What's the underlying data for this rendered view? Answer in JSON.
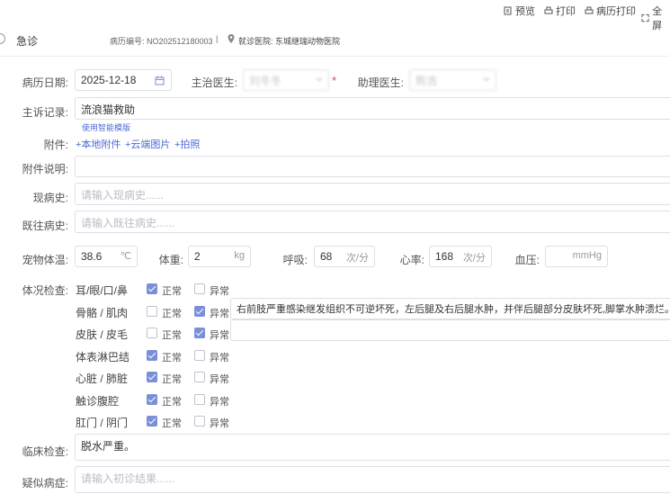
{
  "toolbar": {
    "preview": "预览",
    "print": "打印",
    "record_print": "病历打印",
    "fullscreen": "全屏"
  },
  "header": {
    "status": "急诊",
    "record_no": "病历编号: NO202512180003",
    "sep": "|",
    "hospital": "就诊医院: 东城继瑞动物医院"
  },
  "form": {
    "date_label": "病历日期:",
    "date_value": "2025-12-18",
    "doctor_label": "主治医生:",
    "doctor_value": "刘冬冬",
    "required_mark": "*",
    "assistant_label": "助理医生:",
    "assistant_value": "熊浩",
    "complaint_label": "主诉记录:",
    "complaint_value": "流浪猫救助",
    "template_link": "使用智能模版",
    "attach_label": "附件:",
    "attach_local": "+本地附件",
    "attach_cloud": "+云端图片",
    "attach_photo": "+拍照",
    "attach_desc_label": "附件说明:",
    "present_label": "现病史:",
    "present_placeholder": "请输入现病史......",
    "past_label": "既往病史:",
    "past_placeholder": "请输入既往病史......",
    "temp_label": "宠物体温:",
    "temp_value": "38.6",
    "temp_unit": "℃",
    "weight_label": "体重:",
    "weight_value": "2",
    "weight_unit": "kg",
    "resp_label": "呼吸:",
    "resp_value": "68",
    "resp_unit": "次/分",
    "heart_label": "心率:",
    "heart_value": "168",
    "heart_unit": "次/分",
    "bp_label": "血压:",
    "bp_unit": "mmHg",
    "exam_label": "体况检查:",
    "normal": "正常",
    "abnormal": "异常",
    "clinical_label": "临床检查:",
    "clinical_value": "脱水严重。",
    "suspect_label": "疑似病症:",
    "suspect_placeholder": "请输入初诊结果......"
  },
  "exam_items": [
    {
      "name": "耳/眼/口/鼻",
      "normal": true,
      "abnormal": false,
      "note": ""
    },
    {
      "name": "骨骼 / 肌肉",
      "normal": false,
      "abnormal": true,
      "note": "右前肢严重感染继发组织不可逆坏死，左后腿及右后腿水肿，并伴后腿部分皮肤坏死,脚掌水肿溃烂。"
    },
    {
      "name": "皮肤 / 皮毛",
      "normal": false,
      "abnormal": true,
      "note": ""
    },
    {
      "name": "体表淋巴结",
      "normal": true,
      "abnormal": false,
      "note": ""
    },
    {
      "name": "心脏 / 肺脏",
      "normal": true,
      "abnormal": false,
      "note": ""
    },
    {
      "name": "触诊腹腔",
      "normal": true,
      "abnormal": false,
      "note": ""
    },
    {
      "name": "肛门 / 阴门",
      "normal": true,
      "abnormal": false,
      "note": ""
    }
  ],
  "colors": {
    "accent": "#7b8fd8",
    "link": "#4b6bd6",
    "required": "#e0454e"
  }
}
